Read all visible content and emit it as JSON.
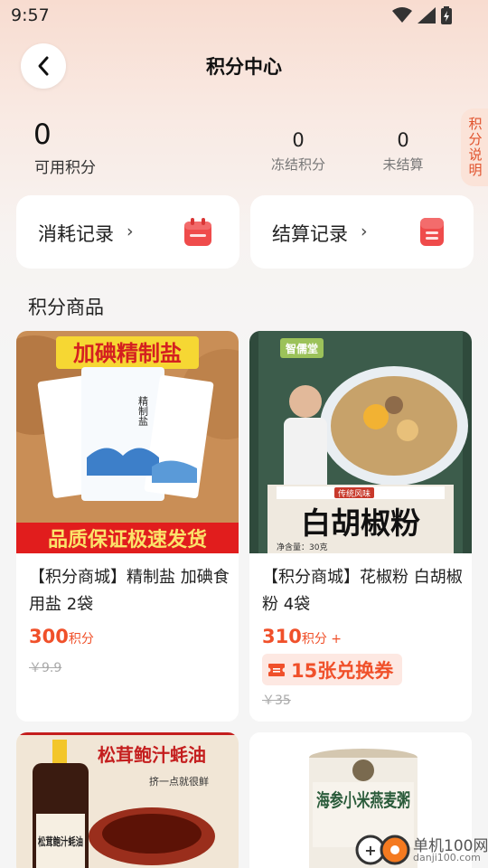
{
  "status_bar": {
    "time": "9:57"
  },
  "header": {
    "title": "积分中心"
  },
  "points": {
    "available_value": "0",
    "available_label": "可用积分",
    "frozen_value": "0",
    "frozen_label": "冻结积分",
    "unsettled_value": "0",
    "unsettled_label": "未结算"
  },
  "rules_tab": {
    "label": "积分说明"
  },
  "records": {
    "consume_label": "消耗记录",
    "settle_label": "结算记录",
    "chevron": "›"
  },
  "section": {
    "title": "积分商品"
  },
  "products": [
    {
      "name": "【积分商城】精制盐 加碘食用盐 2袋",
      "points": "300",
      "points_unit": "积分",
      "original_price": "￥9.9",
      "image_top_text": "加碘精制盐",
      "image_bottom_text": "品质保证极速发货",
      "image_pack_text": "精制盐"
    },
    {
      "name": "【积分商城】花椒粉 白胡椒粉 4袋",
      "points": "310",
      "points_unit": "积分 +",
      "coupon": "15张兑换券",
      "original_price": "￥35",
      "image_brand_text": "智儒堂",
      "image_main_text": "白胡椒粉",
      "image_tag_text": "传统风味",
      "image_weight_text": "净含量：30克"
    },
    {
      "image_title_text": "松茸鲍汁蚝油",
      "image_sub_text": "挤一点就很鲜",
      "image_bottle_text": "松茸鲍汁蚝油"
    },
    {
      "image_title_text": "海参小米燕麦粥"
    }
  ],
  "watermark": {
    "line1": "单机100网",
    "line2": "danji100.com"
  },
  "colors": {
    "accent": "#f0502a",
    "record_icon": "#ef4b4b"
  }
}
